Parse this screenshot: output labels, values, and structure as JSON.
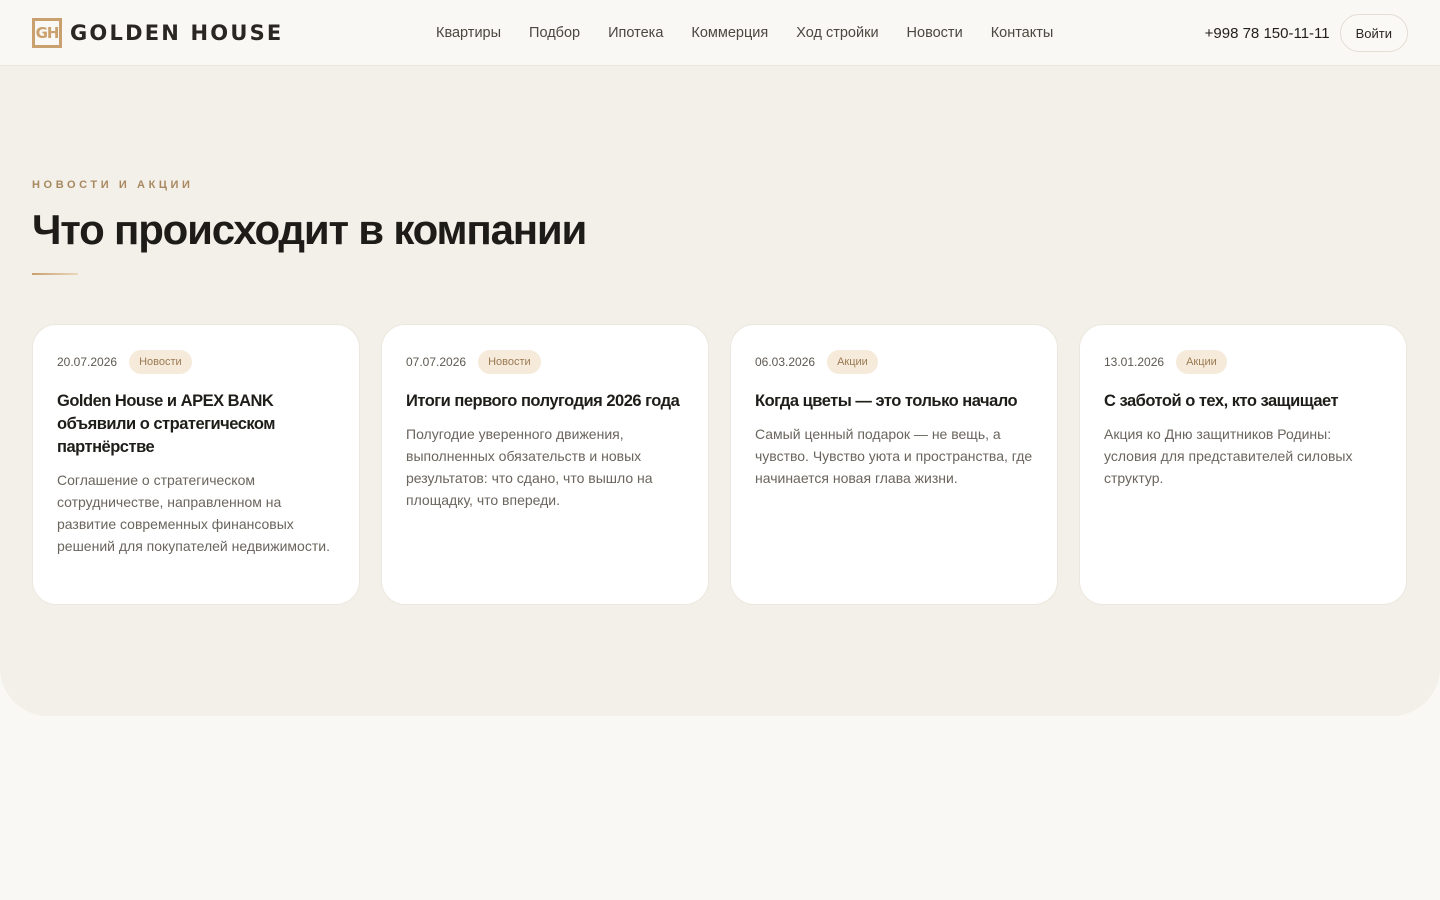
{
  "header": {
    "logo_mark": "GH",
    "logo_text": "GOLDEN HOUSE",
    "nav": [
      "Квартиры",
      "Подбор",
      "Ипотека",
      "Коммерция",
      "Ход стройки",
      "Новости",
      "Контакты"
    ],
    "phone": "+998 78 150-11-11",
    "login_label": "Войти"
  },
  "section": {
    "eyebrow": "НОВОСТИ И АКЦИИ",
    "title": "Что происходит в компании"
  },
  "cards": [
    {
      "date": "20.07.2026",
      "tag": "Новости",
      "title": "Golden House и APEX BANK объявили о стратегическом партнёрстве",
      "text": "Соглашение о стратегическом сотрудничестве, направленном на развитие современных финансовых решений для покупателей недвижимости."
    },
    {
      "date": "07.07.2026",
      "tag": "Новости",
      "title": "Итоги первого полугодия 2026 года",
      "text": "Полугодие уверенного движения, выполненных обязательств и новых результатов: что сдано, что вышло на площадку, что впереди."
    },
    {
      "date": "06.03.2026",
      "tag": "Акции",
      "title": "Когда цветы — это только начало",
      "text": "Самый ценный подарок — не вещь, а чувство. Чувство уюта и пространства, где начинается новая глава жизни."
    },
    {
      "date": "13.01.2026",
      "tag": "Акции",
      "title": "С заботой о тех, кто защищает",
      "text": "Акция ко Дню защитников Родины: условия для представителей силовых структур."
    }
  ],
  "colors": {
    "accent": "#c9a06e",
    "section_bg": "#f3f0e9",
    "page_bg": "#faf8f4",
    "tag_bg": "#f6ebdb"
  }
}
